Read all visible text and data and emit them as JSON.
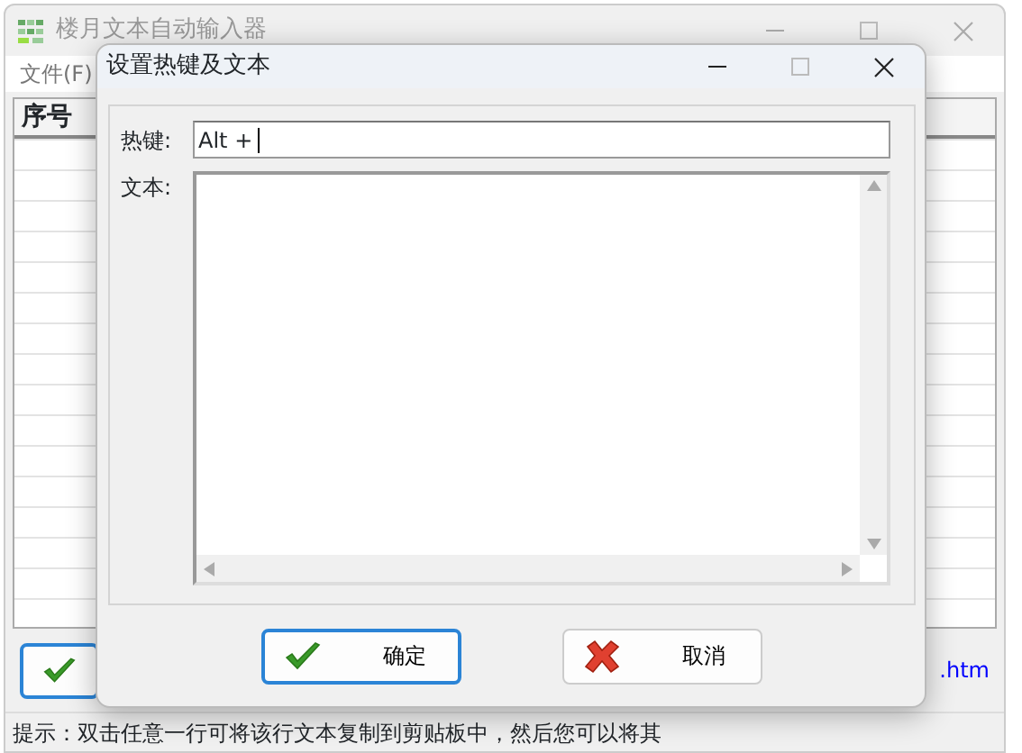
{
  "main_window": {
    "title": "楼月文本自动输入器",
    "menu": [
      "文件(F)"
    ],
    "table": {
      "columns": [
        "序号"
      ]
    },
    "link": ".htm",
    "status_bar": "提示：双击任意一行可将该行文本复制到剪贴板中，然后您可以将其"
  },
  "dialog": {
    "title": "设置热键及文本",
    "hotkey": {
      "label": "热键:",
      "value": "Alt +"
    },
    "text": {
      "label": "文本:"
    },
    "buttons": [
      {
        "label": "确定",
        "kind": "ok",
        "focused": true
      },
      {
        "label": "取消",
        "kind": "cancel",
        "focused": false
      }
    ]
  }
}
